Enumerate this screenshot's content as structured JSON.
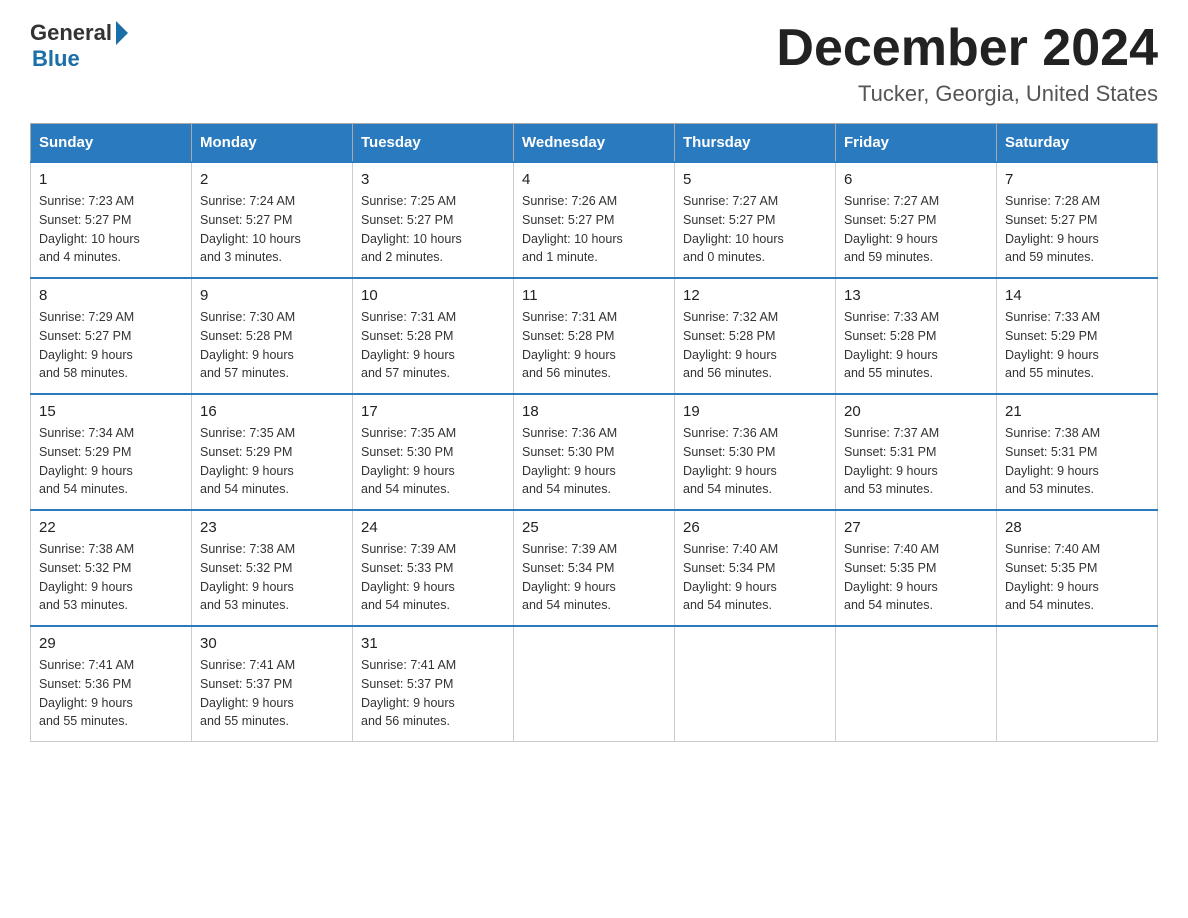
{
  "header": {
    "logo_general": "General",
    "logo_blue": "Blue",
    "month_title": "December 2024",
    "location": "Tucker, Georgia, United States"
  },
  "days_of_week": [
    "Sunday",
    "Monday",
    "Tuesday",
    "Wednesday",
    "Thursday",
    "Friday",
    "Saturday"
  ],
  "weeks": [
    [
      {
        "day": "1",
        "sunrise": "7:23 AM",
        "sunset": "5:27 PM",
        "daylight": "10 hours and 4 minutes."
      },
      {
        "day": "2",
        "sunrise": "7:24 AM",
        "sunset": "5:27 PM",
        "daylight": "10 hours and 3 minutes."
      },
      {
        "day": "3",
        "sunrise": "7:25 AM",
        "sunset": "5:27 PM",
        "daylight": "10 hours and 2 minutes."
      },
      {
        "day": "4",
        "sunrise": "7:26 AM",
        "sunset": "5:27 PM",
        "daylight": "10 hours and 1 minute."
      },
      {
        "day": "5",
        "sunrise": "7:27 AM",
        "sunset": "5:27 PM",
        "daylight": "10 hours and 0 minutes."
      },
      {
        "day": "6",
        "sunrise": "7:27 AM",
        "sunset": "5:27 PM",
        "daylight": "9 hours and 59 minutes."
      },
      {
        "day": "7",
        "sunrise": "7:28 AM",
        "sunset": "5:27 PM",
        "daylight": "9 hours and 59 minutes."
      }
    ],
    [
      {
        "day": "8",
        "sunrise": "7:29 AM",
        "sunset": "5:27 PM",
        "daylight": "9 hours and 58 minutes."
      },
      {
        "day": "9",
        "sunrise": "7:30 AM",
        "sunset": "5:28 PM",
        "daylight": "9 hours and 57 minutes."
      },
      {
        "day": "10",
        "sunrise": "7:31 AM",
        "sunset": "5:28 PM",
        "daylight": "9 hours and 57 minutes."
      },
      {
        "day": "11",
        "sunrise": "7:31 AM",
        "sunset": "5:28 PM",
        "daylight": "9 hours and 56 minutes."
      },
      {
        "day": "12",
        "sunrise": "7:32 AM",
        "sunset": "5:28 PM",
        "daylight": "9 hours and 56 minutes."
      },
      {
        "day": "13",
        "sunrise": "7:33 AM",
        "sunset": "5:28 PM",
        "daylight": "9 hours and 55 minutes."
      },
      {
        "day": "14",
        "sunrise": "7:33 AM",
        "sunset": "5:29 PM",
        "daylight": "9 hours and 55 minutes."
      }
    ],
    [
      {
        "day": "15",
        "sunrise": "7:34 AM",
        "sunset": "5:29 PM",
        "daylight": "9 hours and 54 minutes."
      },
      {
        "day": "16",
        "sunrise": "7:35 AM",
        "sunset": "5:29 PM",
        "daylight": "9 hours and 54 minutes."
      },
      {
        "day": "17",
        "sunrise": "7:35 AM",
        "sunset": "5:30 PM",
        "daylight": "9 hours and 54 minutes."
      },
      {
        "day": "18",
        "sunrise": "7:36 AM",
        "sunset": "5:30 PM",
        "daylight": "9 hours and 54 minutes."
      },
      {
        "day": "19",
        "sunrise": "7:36 AM",
        "sunset": "5:30 PM",
        "daylight": "9 hours and 54 minutes."
      },
      {
        "day": "20",
        "sunrise": "7:37 AM",
        "sunset": "5:31 PM",
        "daylight": "9 hours and 53 minutes."
      },
      {
        "day": "21",
        "sunrise": "7:38 AM",
        "sunset": "5:31 PM",
        "daylight": "9 hours and 53 minutes."
      }
    ],
    [
      {
        "day": "22",
        "sunrise": "7:38 AM",
        "sunset": "5:32 PM",
        "daylight": "9 hours and 53 minutes."
      },
      {
        "day": "23",
        "sunrise": "7:38 AM",
        "sunset": "5:32 PM",
        "daylight": "9 hours and 53 minutes."
      },
      {
        "day": "24",
        "sunrise": "7:39 AM",
        "sunset": "5:33 PM",
        "daylight": "9 hours and 54 minutes."
      },
      {
        "day": "25",
        "sunrise": "7:39 AM",
        "sunset": "5:34 PM",
        "daylight": "9 hours and 54 minutes."
      },
      {
        "day": "26",
        "sunrise": "7:40 AM",
        "sunset": "5:34 PM",
        "daylight": "9 hours and 54 minutes."
      },
      {
        "day": "27",
        "sunrise": "7:40 AM",
        "sunset": "5:35 PM",
        "daylight": "9 hours and 54 minutes."
      },
      {
        "day": "28",
        "sunrise": "7:40 AM",
        "sunset": "5:35 PM",
        "daylight": "9 hours and 54 minutes."
      }
    ],
    [
      {
        "day": "29",
        "sunrise": "7:41 AM",
        "sunset": "5:36 PM",
        "daylight": "9 hours and 55 minutes."
      },
      {
        "day": "30",
        "sunrise": "7:41 AM",
        "sunset": "5:37 PM",
        "daylight": "9 hours and 55 minutes."
      },
      {
        "day": "31",
        "sunrise": "7:41 AM",
        "sunset": "5:37 PM",
        "daylight": "9 hours and 56 minutes."
      },
      null,
      null,
      null,
      null
    ]
  ],
  "labels": {
    "sunrise": "Sunrise:",
    "sunset": "Sunset:",
    "daylight": "Daylight:"
  }
}
